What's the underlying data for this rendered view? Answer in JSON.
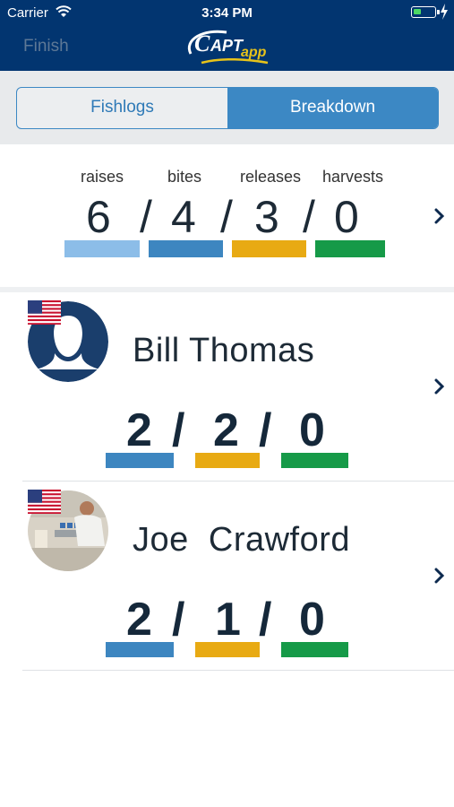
{
  "status": {
    "carrier": "Carrier",
    "time": "3:34 PM",
    "battery_level": 0.4
  },
  "nav": {
    "finish_label": "Finish",
    "logo_text": "CAPTapp"
  },
  "tabs": [
    {
      "label": "Fishlogs",
      "active": false
    },
    {
      "label": "Breakdown",
      "active": true
    }
  ],
  "summary": {
    "labels": {
      "raises": "raises",
      "bites": "bites",
      "releases": "releases",
      "harvests": "harvests"
    },
    "values": {
      "raises": "6",
      "bites": "4",
      "releases": "3",
      "harvests": "0"
    },
    "separator": "/"
  },
  "colors": {
    "navy": "#023570",
    "raises": "#8cbde8",
    "bites": "#3d86c0",
    "releases": "#e8aa13",
    "harvests": "#169a48"
  },
  "anglers": [
    {
      "name": "Bill Thomas",
      "bites": "2",
      "releases": "2",
      "harvests": "0",
      "flag": "us-flag-icon",
      "avatar": "placeholder-person-icon"
    },
    {
      "name": "Joe  Crawford",
      "bites": "2",
      "releases": "1",
      "harvests": "0",
      "flag": "us-flag-icon",
      "avatar": "photo-avatar"
    }
  ]
}
